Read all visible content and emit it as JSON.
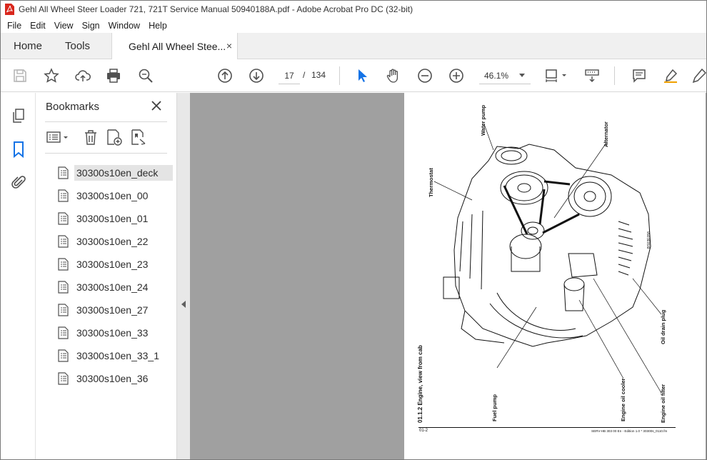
{
  "window": {
    "title": "Gehl All Wheel Steer Loader 721, 721T Service Manual 50940188A.pdf - Adobe Acrobat Pro DC (32-bit)"
  },
  "menu": [
    "File",
    "Edit",
    "View",
    "Sign",
    "Window",
    "Help"
  ],
  "tabs": {
    "home": "Home",
    "tools": "Tools",
    "document": "Gehl All Wheel Stee...",
    "close_glyph": "×"
  },
  "toolbar": {
    "current_page": "17",
    "page_separator": "/",
    "total_pages": "134",
    "zoom": "46.1%"
  },
  "bookmarks": {
    "title": "Bookmarks",
    "close_glyph": "×",
    "items": [
      {
        "label": "30300s10en_deck",
        "selected": true
      },
      {
        "label": "30300s10en_00"
      },
      {
        "label": "30300s10en_01"
      },
      {
        "label": "30300s10en_22"
      },
      {
        "label": "30300s10en_23"
      },
      {
        "label": "30300s10en_24"
      },
      {
        "label": "30300s10en_27"
      },
      {
        "label": "30300s10en_33"
      },
      {
        "label": "30300s10en_33_1"
      },
      {
        "label": "30300s10en_36"
      }
    ]
  },
  "document_page": {
    "caption": "01.1.2  Engine, view from cab",
    "labels": {
      "water_pump": "Water pump",
      "alternator": "Alternator",
      "thermostat": "Thermostat",
      "oil_drain_plug": "Oil drain plug",
      "fuel_pump": "Fuel pump",
      "engine_oil_cooler": "Engine oil cooler",
      "engine_oil_filter": "Engine oil filter",
      "side_code": "BS03E058"
    },
    "footer_left": "01-2",
    "footer_right": "SERV-HB 303 00 En - Edition 1.0 * 30300s_0110.fm"
  },
  "colors": {
    "accent_blue": "#1473e6",
    "doc_background": "#a0a0a0",
    "tab_bar": "#f0f0f0"
  }
}
